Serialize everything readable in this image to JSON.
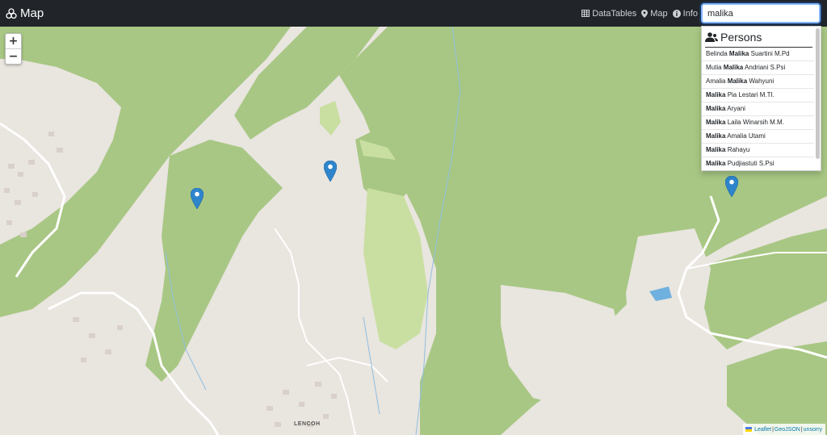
{
  "navbar": {
    "brand": "Map",
    "links": [
      {
        "label": "DataTables",
        "icon": "table-icon"
      },
      {
        "label": "Map",
        "icon": "map-marker-icon"
      },
      {
        "label": "Info",
        "icon": "info-circle-icon"
      }
    ]
  },
  "search": {
    "value": "malika"
  },
  "results": {
    "header": "Persons",
    "items": [
      {
        "pre": "Belinda ",
        "match": "Malika",
        "post": " Suartini M.Pd"
      },
      {
        "pre": "Mutia ",
        "match": "Malika",
        "post": " Andriani S.Psi"
      },
      {
        "pre": "Amalia ",
        "match": "Malika",
        "post": " Wahyuni"
      },
      {
        "pre": "",
        "match": "Malika",
        "post": " Pia Lestari M.TI."
      },
      {
        "pre": "",
        "match": "Malika",
        "post": " Aryani"
      },
      {
        "pre": "",
        "match": "Malika",
        "post": " Laila Winarsih M.M."
      },
      {
        "pre": "",
        "match": "Malika",
        "post": " Amalia Utami"
      },
      {
        "pre": "",
        "match": "Malika",
        "post": " Rahayu"
      },
      {
        "pre": "",
        "match": "Malika",
        "post": " Pudjiastuti S.Psi"
      }
    ]
  },
  "map": {
    "zoom_in": "+",
    "zoom_out": "−",
    "place_label": "LENCOH",
    "marker_color": "#2e85cb"
  },
  "attribution": {
    "leaflet": "Leaflet",
    "sep1": "|",
    "geojson": "GeoJSON",
    "sep2": "|",
    "unsorry": "unsorry"
  }
}
